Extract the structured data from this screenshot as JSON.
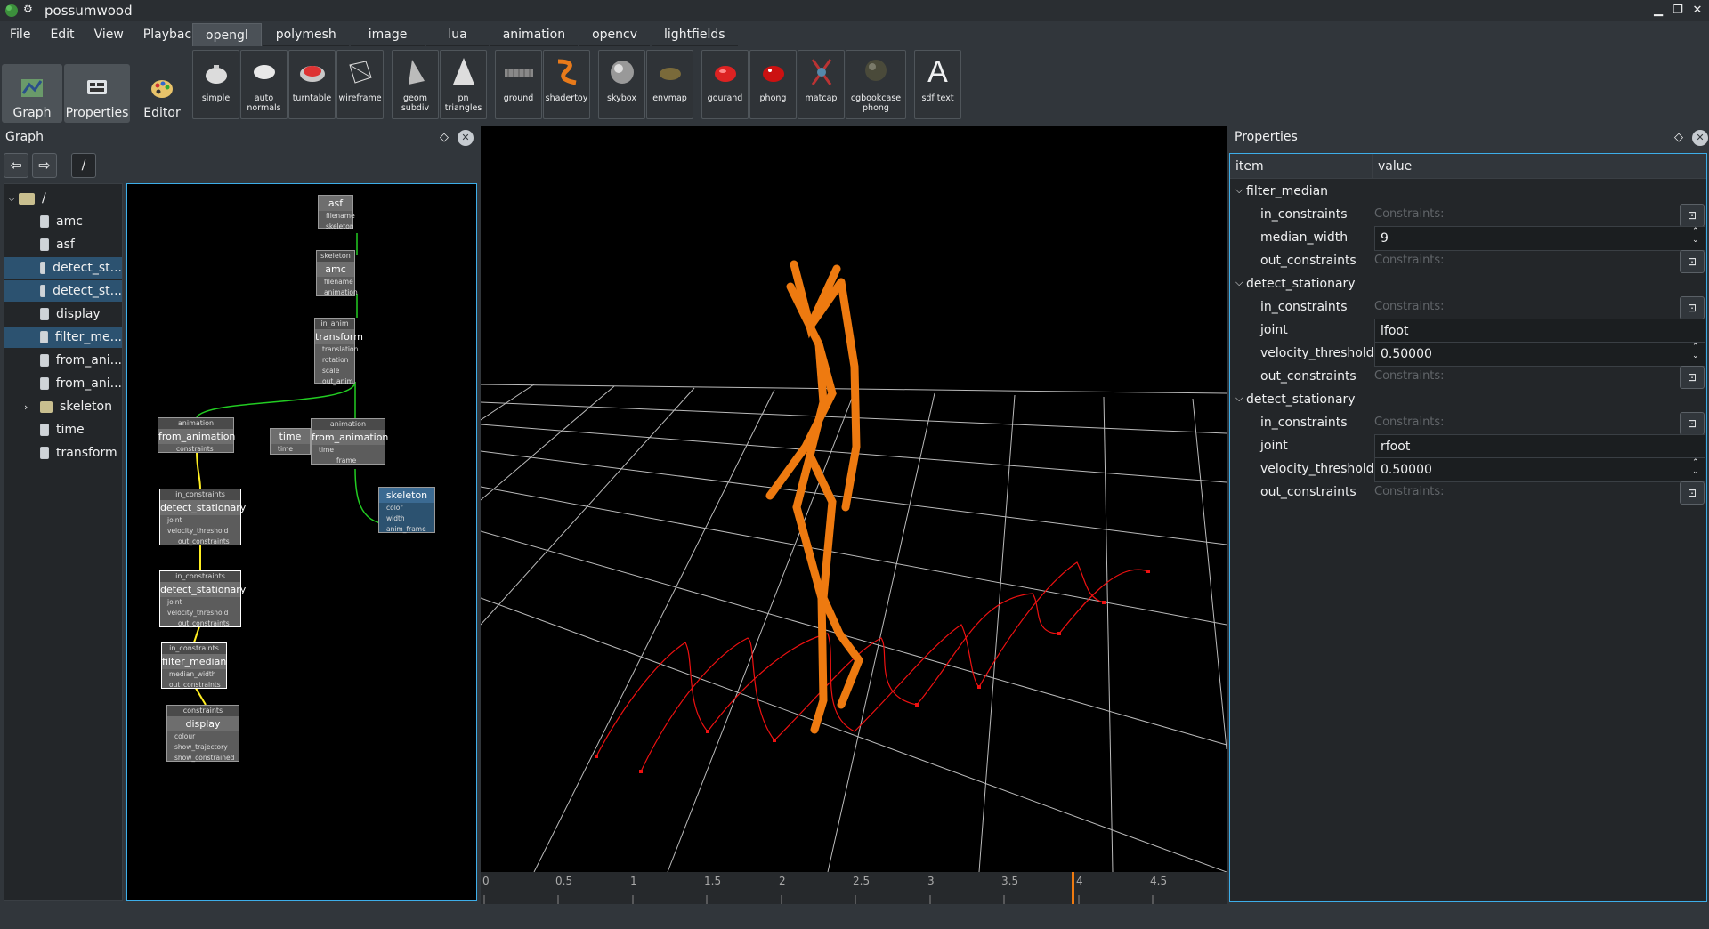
{
  "window": {
    "title": "possumwood"
  },
  "menu": [
    "File",
    "Edit",
    "View",
    "Playback"
  ],
  "modes": [
    {
      "label": "Graph",
      "icon": "graph-icon"
    },
    {
      "label": "Properties",
      "icon": "properties-icon"
    },
    {
      "label": "Editor",
      "icon": "palette-icon"
    }
  ],
  "tabs": [
    "opengl",
    "polymesh",
    "image",
    "lua",
    "animation",
    "opencv",
    "lightfields"
  ],
  "tools": [
    {
      "label": "simple",
      "icon": "teapot-icon"
    },
    {
      "label": "auto normals",
      "icon": "teapot-icon"
    },
    {
      "label": "turntable",
      "icon": "teapot-red-icon"
    },
    {
      "label": "wireframe",
      "icon": "wireframe-icon"
    },
    {
      "label": "geom subdiv",
      "icon": "subdiv-icon"
    },
    {
      "label": "pn triangles",
      "icon": "cone-icon"
    },
    {
      "label": "ground",
      "icon": "ground-icon"
    },
    {
      "label": "shadertoy",
      "icon": "shadertoy-icon"
    },
    {
      "label": "skybox",
      "icon": "sphere-icon"
    },
    {
      "label": "envmap",
      "icon": "envmap-icon"
    },
    {
      "label": "gourand",
      "icon": "teapot-red-icon"
    },
    {
      "label": "phong",
      "icon": "teapot-red-icon"
    },
    {
      "label": "matcap",
      "icon": "matcap-icon"
    },
    {
      "label": "cgbookcase phong",
      "icon": "rock-icon"
    },
    {
      "label": "sdf text",
      "icon": "letter-a-icon"
    }
  ],
  "graph": {
    "title": "Graph",
    "path": "/",
    "tree": [
      {
        "label": "/",
        "type": "folder",
        "selected": false
      },
      {
        "label": "amc",
        "type": "file",
        "selected": false
      },
      {
        "label": "asf",
        "type": "file",
        "selected": false
      },
      {
        "label": "detect_st...",
        "type": "file",
        "selected": true
      },
      {
        "label": "detect_st...",
        "type": "file",
        "selected": true
      },
      {
        "label": "display",
        "type": "file",
        "selected": false
      },
      {
        "label": "filter_me...",
        "type": "file",
        "selected": true
      },
      {
        "label": "from_ani...",
        "type": "file",
        "selected": false
      },
      {
        "label": "from_ani...",
        "type": "file",
        "selected": false
      },
      {
        "label": "skeleton",
        "type": "folder",
        "selected": false
      },
      {
        "label": "time",
        "type": "file",
        "selected": false
      },
      {
        "label": "transform",
        "type": "file",
        "selected": false
      }
    ],
    "nodes": {
      "asf": {
        "name": "asf",
        "ports": [
          "filename",
          "skeleton"
        ]
      },
      "amc": {
        "header": "skeleton",
        "name": "amc",
        "ports": [
          "filename",
          "animation"
        ]
      },
      "transform": {
        "header": "in_anim",
        "name": "transform",
        "ports": [
          "translation",
          "rotation",
          "scale",
          "out_anim"
        ]
      },
      "from_animation_1": {
        "header": "animation",
        "name": "from_animation",
        "ports": [
          "constraints"
        ]
      },
      "time": {
        "name": "time",
        "ports": [
          "time"
        ]
      },
      "from_animation_2": {
        "header": "animation",
        "name": "from_animation",
        "ports": [
          "time",
          "frame"
        ]
      },
      "skeleton": {
        "name": "skeleton",
        "ports": [
          "color",
          "width",
          "anim_frame"
        ]
      },
      "detect_1": {
        "header": "in_constraints",
        "name": "detect_stationary",
        "ports": [
          "joint",
          "velocity_threshold",
          "out_constraints"
        ]
      },
      "detect_2": {
        "header": "in_constraints",
        "name": "detect_stationary",
        "ports": [
          "joint",
          "velocity_threshold",
          "out_constraints"
        ]
      },
      "filter": {
        "header": "in_constraints",
        "name": "filter_median",
        "ports": [
          "median_width",
          "out_constraints"
        ]
      },
      "display": {
        "header": "constraints",
        "name": "display",
        "ports": [
          "colour",
          "show_trajectory",
          "show_constrained"
        ]
      }
    }
  },
  "timeline": {
    "ticks": [
      "0",
      "0.5",
      "1",
      "1.5",
      "2",
      "2.5",
      "3",
      "3.5",
      "4",
      "4.5"
    ],
    "current": 3.95
  },
  "properties": {
    "title": "Properties",
    "col_item": "item",
    "col_value": "value",
    "constraints_placeholder": "Constraints:",
    "groups": [
      {
        "name": "filter_median",
        "rows": [
          {
            "label": "in_constraints",
            "kind": "constraints"
          },
          {
            "label": "median_width",
            "kind": "spin",
            "value": "9"
          },
          {
            "label": "out_constraints",
            "kind": "constraints"
          }
        ]
      },
      {
        "name": "detect_stationary",
        "rows": [
          {
            "label": "in_constraints",
            "kind": "constraints"
          },
          {
            "label": "joint",
            "kind": "text",
            "value": "lfoot"
          },
          {
            "label": "velocity_threshold",
            "kind": "spin",
            "value": "0.50000"
          },
          {
            "label": "out_constraints",
            "kind": "constraints"
          }
        ]
      },
      {
        "name": "detect_stationary",
        "rows": [
          {
            "label": "in_constraints",
            "kind": "constraints"
          },
          {
            "label": "joint",
            "kind": "text",
            "value": "rfoot"
          },
          {
            "label": "velocity_threshold",
            "kind": "spin",
            "value": "0.50000"
          },
          {
            "label": "out_constraints",
            "kind": "constraints"
          }
        ]
      }
    ]
  }
}
